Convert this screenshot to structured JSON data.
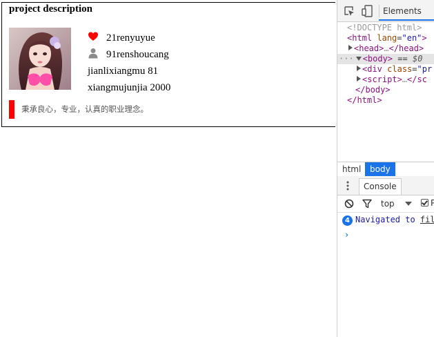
{
  "page": {
    "title": "project description",
    "stats": [
      {
        "icon": "heart-icon",
        "text": "21renyuyue"
      },
      {
        "icon": "person-icon",
        "text": "91renshoucang"
      },
      {
        "text": "jianlixiangmu 81"
      },
      {
        "text": "xiangmujunjia 2000"
      }
    ],
    "motto": "秉承良心，专业，认真的职业理念。",
    "accent_color": "#ff0000"
  },
  "devtools": {
    "tab_elements": "Elements",
    "dom": {
      "doctype": "<!DOCTYPE html>",
      "html_open": "<html",
      "html_attr": "lang",
      "html_attr_val": "\"en\"",
      "html_gt": ">",
      "head": "<head>",
      "head_ellipsis": "…",
      "head_close": "</head>",
      "body_tag": "<body>",
      "body_eq": "==",
      "body_ref": "$0",
      "div_tag": "<div",
      "div_attr": "class",
      "div_attr_val": "\"pr",
      "script_tag": "<script>",
      "script_ellipsis": "…",
      "script_close": "</sc",
      "body_close": "</body>",
      "html_close": "</html>"
    },
    "breadcrumbs": [
      "html",
      "body"
    ],
    "tab_console": "Console",
    "context": "top",
    "preserve_label": "P",
    "message_count": "4",
    "message_text": "Navigated to ",
    "message_link": "fil",
    "prompt": "›"
  }
}
